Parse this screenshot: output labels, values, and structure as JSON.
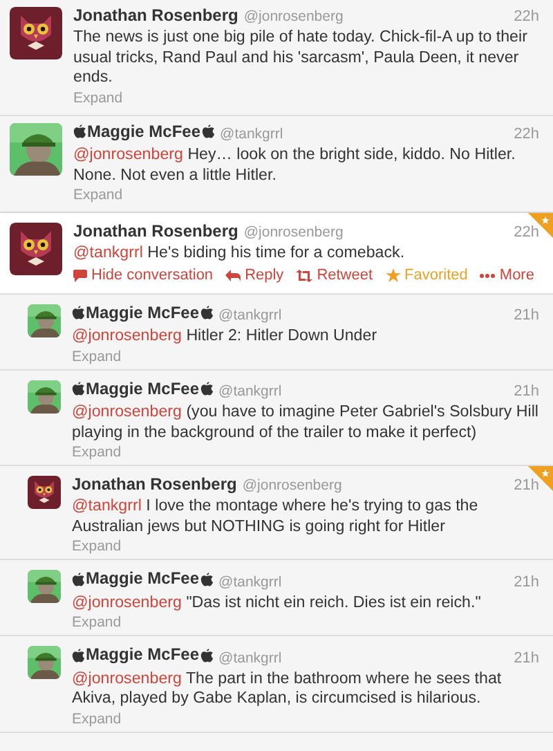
{
  "tweets": [
    {
      "name": "Jonathan Rosenberg",
      "handle": "@jonrosenberg",
      "time": "22h",
      "avatar": {
        "kind": "owl"
      },
      "apple_marks": false,
      "reply": false,
      "selected": false,
      "favorited": false,
      "text": "The news is just one big pile of hate today. Chick-fil-A up to their usual tricks, Rand Paul and his 'sarcasm', Paula Deen, it never ends.",
      "expand": "Expand"
    },
    {
      "name": "Maggie McFee",
      "handle": "@tankgrrl",
      "time": "22h",
      "apple_marks": true,
      "reply": false,
      "selected": false,
      "favorited": false,
      "mention": "@jonrosenberg",
      "text": "Hey… look on the bright side, kiddo. No Hitler. None. Not even a little Hitler.",
      "expand": "Expand"
    },
    {
      "name": "Jonathan Rosenberg",
      "handle": "@jonrosenberg",
      "time": "22h",
      "avatar": {
        "kind": "owl"
      },
      "apple_marks": false,
      "reply": false,
      "selected": true,
      "favorited": true,
      "mention": "@tankgrrl",
      "text": "He's biding his time for a comeback.",
      "actions": [
        {
          "kind": "conversation",
          "label": "Hide conversation"
        },
        {
          "kind": "reply",
          "label": "Reply"
        },
        {
          "kind": "retweet",
          "label": "Retweet"
        },
        {
          "kind": "favorite",
          "label": "Favorited"
        },
        {
          "kind": "more",
          "label": "More"
        }
      ]
    },
    {
      "name": "Maggie McFee",
      "handle": "@tankgrrl",
      "time": "21h",
      "apple_marks": true,
      "reply": true,
      "selected": false,
      "favorited": false,
      "mention": "@jonrosenberg",
      "text": "Hitler 2: Hitler Down Under",
      "expand": "Expand"
    },
    {
      "name": "Maggie McFee",
      "handle": "@tankgrrl",
      "time": "21h",
      "apple_marks": true,
      "reply": true,
      "selected": false,
      "favorited": false,
      "mention": "@jonrosenberg",
      "text": "(you have to imagine Peter Gabriel's Solsbury Hill playing in the background of the trailer to make it perfect)",
      "expand": "Expand"
    },
    {
      "name": "Jonathan Rosenberg",
      "handle": "@jonrosenberg",
      "time": "21h",
      "avatar": {
        "kind": "owl"
      },
      "apple_marks": false,
      "reply": true,
      "selected": false,
      "favorited": true,
      "mention": "@tankgrrl",
      "text": "I love the montage where he's trying to gas the Australian jews but NOTHING is going right for Hitler",
      "expand": "Expand"
    },
    {
      "name": "Maggie McFee",
      "handle": "@tankgrrl",
      "time": "21h",
      "apple_marks": true,
      "reply": true,
      "selected": false,
      "favorited": false,
      "mention": "@jonrosenberg",
      "text": "\"Das ist nicht ein reich. Dies ist ein reich.\"",
      "expand": "Expand"
    },
    {
      "name": "Maggie McFee",
      "handle": "@tankgrrl",
      "time": "21h",
      "apple_marks": true,
      "reply": true,
      "selected": false,
      "favorited": false,
      "mention": "@jonrosenberg",
      "text": "The part in the bathroom where he sees that Akiva, played by Gabe Kaplan, is circumcised is hilarious.",
      "expand": "Expand"
    }
  ]
}
